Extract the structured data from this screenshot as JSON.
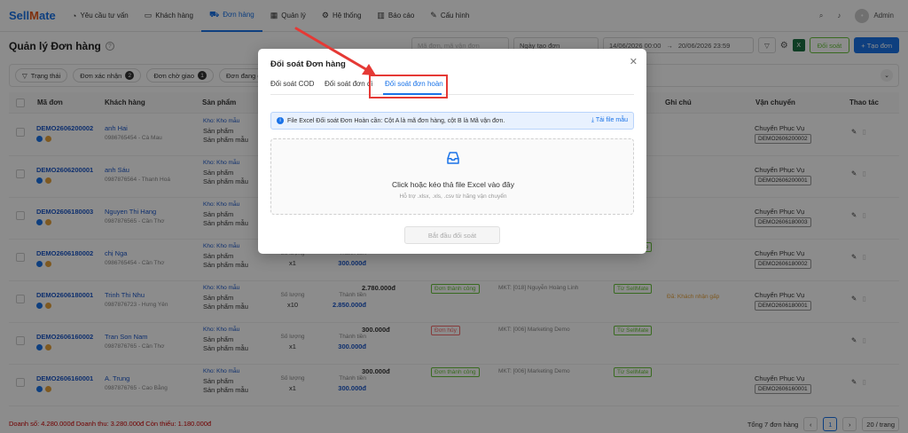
{
  "app": {
    "logo_a": "Sell",
    "logo_b": "M",
    "logo_c": "ate"
  },
  "nav": [
    {
      "label": "Yêu cầu tư vấn",
      "icon": "chat-icon"
    },
    {
      "label": "Khách hàng",
      "icon": "user-icon"
    },
    {
      "label": "Đơn hàng",
      "icon": "cart-icon"
    },
    {
      "label": "Quản lý",
      "icon": "grid-icon"
    },
    {
      "label": "Hệ thống",
      "icon": "gear-icon"
    },
    {
      "label": "Báo cáo",
      "icon": "chart-icon"
    },
    {
      "label": "Cấu hình",
      "icon": "wrench-icon"
    }
  ],
  "user": {
    "name": "Admin"
  },
  "page": {
    "title": "Quản lý Đơn hàng"
  },
  "toolbar": {
    "search_placeholder": "Mã đơn, mã vận đơn",
    "date_type": "Ngày tạo đơn",
    "date_from": "14/06/2026 00:00",
    "date_sep": "→",
    "date_to": "20/06/2026 23:59",
    "reconcile": "Đối soát",
    "create": "Tạo đơn"
  },
  "status_tabs": [
    {
      "label": "Trạng thái",
      "count": ""
    },
    {
      "label": "Đơn xác nhận",
      "count": "2"
    },
    {
      "label": "Đơn chờ giao",
      "count": "1"
    },
    {
      "label": "Đơn đang giao",
      "count": "1"
    }
  ],
  "columns": {
    "code": "Mã đơn",
    "customer": "Khách hàng",
    "product": "Sản phẩm",
    "note": "Ghi chú",
    "shipping": "Vận chuyển",
    "actions": "Thao tác"
  },
  "rows": [
    {
      "code": "DEMO2606200002",
      "name": "anh Hai",
      "phone": "0986765454 - Cà Mau",
      "warehouse": "Kho: Kho mẫu",
      "p1": "Sản phẩm",
      "p2": "Sản phẩm mẫu",
      "qty_label": "",
      "qty": "",
      "total_label": "",
      "total": "",
      "amount": "",
      "status": "",
      "ship_label": "Chuyển Phục Vụ",
      "ship_code": "DEMO2606200002",
      "source": "",
      "mkt": "",
      "note": ""
    },
    {
      "code": "DEMO2606200001",
      "name": "anh Sáu",
      "phone": "0987876564 - Thanh Hoá",
      "warehouse": "Kho: Kho mẫu",
      "p1": "Sản phẩm",
      "p2": "Sản phẩm mẫu",
      "qty_label": "",
      "qty": "",
      "total_label": "",
      "total": "",
      "amount": "",
      "status": "",
      "ship_label": "Chuyển Phục Vụ",
      "ship_code": "DEMO2606200001",
      "source": "",
      "mkt": "",
      "note": ""
    },
    {
      "code": "DEMO2606180003",
      "name": "Nguyen Thi Hang",
      "phone": "0987876565 - Cần Thơ",
      "warehouse": "Kho: Kho mẫu",
      "p1": "Sản phẩm",
      "p2": "Sản phẩm mẫu",
      "qty_label": "",
      "qty": "",
      "total_label": "",
      "total": "",
      "amount": "",
      "status": "",
      "ship_label": "Chuyển Phục Vụ",
      "ship_code": "DEMO2606180003",
      "source": "",
      "mkt": "",
      "note": ""
    },
    {
      "code": "DEMO2606180002",
      "name": "chị Nga",
      "phone": "0986765454 - Cần Thơ",
      "warehouse": "Kho: Kho mẫu",
      "p1": "Sản phẩm",
      "p2": "Sản phẩm mẫu",
      "qty_label": "Số lượng",
      "qty": "x1",
      "total_label": "Thành tiền",
      "total": "300.000đ",
      "amount": "Thành tiền: 300.000đ",
      "status": "COD",
      "ship_label": "Chuyển Phục Vụ",
      "ship_code": "DEMO2606180002",
      "source": "Từ SellMate",
      "mkt": "Người tạo: [001] SuperAdmin",
      "note": ""
    },
    {
      "code": "DEMO2606180001",
      "name": "Trinh Thi Nhu",
      "phone": "0987876723 - Hưng Yên",
      "warehouse": "Kho: Kho mẫu",
      "p1": "Sản phẩm",
      "p2": "Sản phẩm mẫu",
      "qty_label": "Số lượng",
      "qty": "x10",
      "total_label": "Thành tiền",
      "total": "2.850.000đ",
      "amount": "2.780.000đ",
      "status": "Đơn thành công",
      "ship_label": "Chuyển Phục Vụ",
      "ship_code": "DEMO2606180001",
      "source": "Từ SellMate",
      "mkt": "MKT: [018] Nguyễn Hoàng Linh",
      "note": "Đã: Khách nhận gấp"
    },
    {
      "code": "DEMO2606160002",
      "name": "Tran Son Nam",
      "phone": "0987876765 - Cần Thơ",
      "warehouse": "Kho: Kho mẫu",
      "p1": "Sản phẩm",
      "p2": "Sản phẩm mẫu",
      "qty_label": "Số lượng",
      "qty": "x1",
      "total_label": "Thành tiền",
      "total": "300.000đ",
      "amount": "300.000đ",
      "status": "Đơn hủy",
      "ship_label": "",
      "ship_code": "",
      "source": "Từ SellMate",
      "mkt": "MKT: [006] Marketing Demo",
      "note": ""
    },
    {
      "code": "DEMO2606160001",
      "name": "A. Trung",
      "phone": "0987876765 - Cao Bằng",
      "warehouse": "Kho: Kho mẫu",
      "p1": "Sản phẩm",
      "p2": "Sản phẩm mẫu",
      "qty_label": "Số lượng",
      "qty": "x1",
      "total_label": "Thành tiền",
      "total": "300.000đ",
      "amount": "300.000đ",
      "status": "Đơn thành công",
      "ship_label": "Chuyển Phục Vụ",
      "ship_code": "DEMO2606160001",
      "source": "Từ SellMate",
      "mkt": "MKT: [006] Marketing Demo",
      "note": ""
    }
  ],
  "modal": {
    "title": "Đối soát Đơn hàng",
    "tabs": [
      "Đối soát COD",
      "Đối soát đơn đi",
      "Đối soát đơn hoàn"
    ],
    "info": "File Excel Đối soát Đơn Hoàn cần: Cột A là mã đơn hàng, cột B là Mã vận đơn.",
    "download": "Tải file mẫu",
    "drop_title": "Click hoặc kéo thả file Excel vào đây",
    "drop_hint": "Hỗ trợ .xlsx, .xls, .csv từ hãng vận chuyển",
    "start": "Bắt đầu đối soát"
  },
  "footer": {
    "summary": "Doanh số: 4.280.000đ   Doanh thu: 3.280.000đ   Còn thiếu: 1.180.000đ",
    "total": "Tổng 7 đơn hàng",
    "page": "1",
    "per_page": "20 / trang"
  },
  "colors": {
    "accent": "#1a73e8",
    "annotation": "#e53935"
  }
}
